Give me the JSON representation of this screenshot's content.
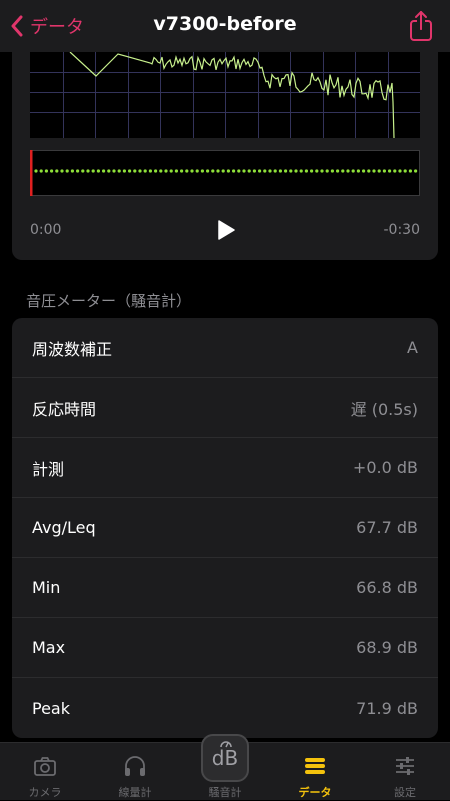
{
  "nav": {
    "back_label": "データ",
    "title": "v7300-before"
  },
  "player": {
    "time_start": "0:00",
    "time_end": "-0:30"
  },
  "section": {
    "title": "音圧メーター（騒音計）"
  },
  "rows": [
    {
      "label": "周波数補正",
      "value": "A"
    },
    {
      "label": "反応時間",
      "value": "遅 (0.5s)"
    },
    {
      "label": "計測",
      "value": "+0.0 dB"
    },
    {
      "label": "Avg/Leq",
      "value": "67.7 dB"
    },
    {
      "label": "Min",
      "value": "66.8 dB"
    },
    {
      "label": "Max",
      "value": "68.9 dB"
    },
    {
      "label": "Peak",
      "value": "71.9 dB"
    }
  ],
  "tabs": [
    {
      "label": "カメラ",
      "icon": "camera-icon",
      "active": false
    },
    {
      "label": "線量計",
      "icon": "headphones-icon",
      "active": false
    },
    {
      "label": "騒音計",
      "icon": "db-meter-icon",
      "active": false
    },
    {
      "label": "データ",
      "icon": "data-icon",
      "active": true
    },
    {
      "label": "設定",
      "icon": "sliders-icon",
      "active": false
    }
  ],
  "db_button": {
    "label": "dB"
  },
  "colors": {
    "accent": "#e0356b",
    "spectrum": "#c7f08c",
    "timeline": "#8fe03a",
    "playhead": "#e02020",
    "active_tab": "#f4c20d"
  }
}
